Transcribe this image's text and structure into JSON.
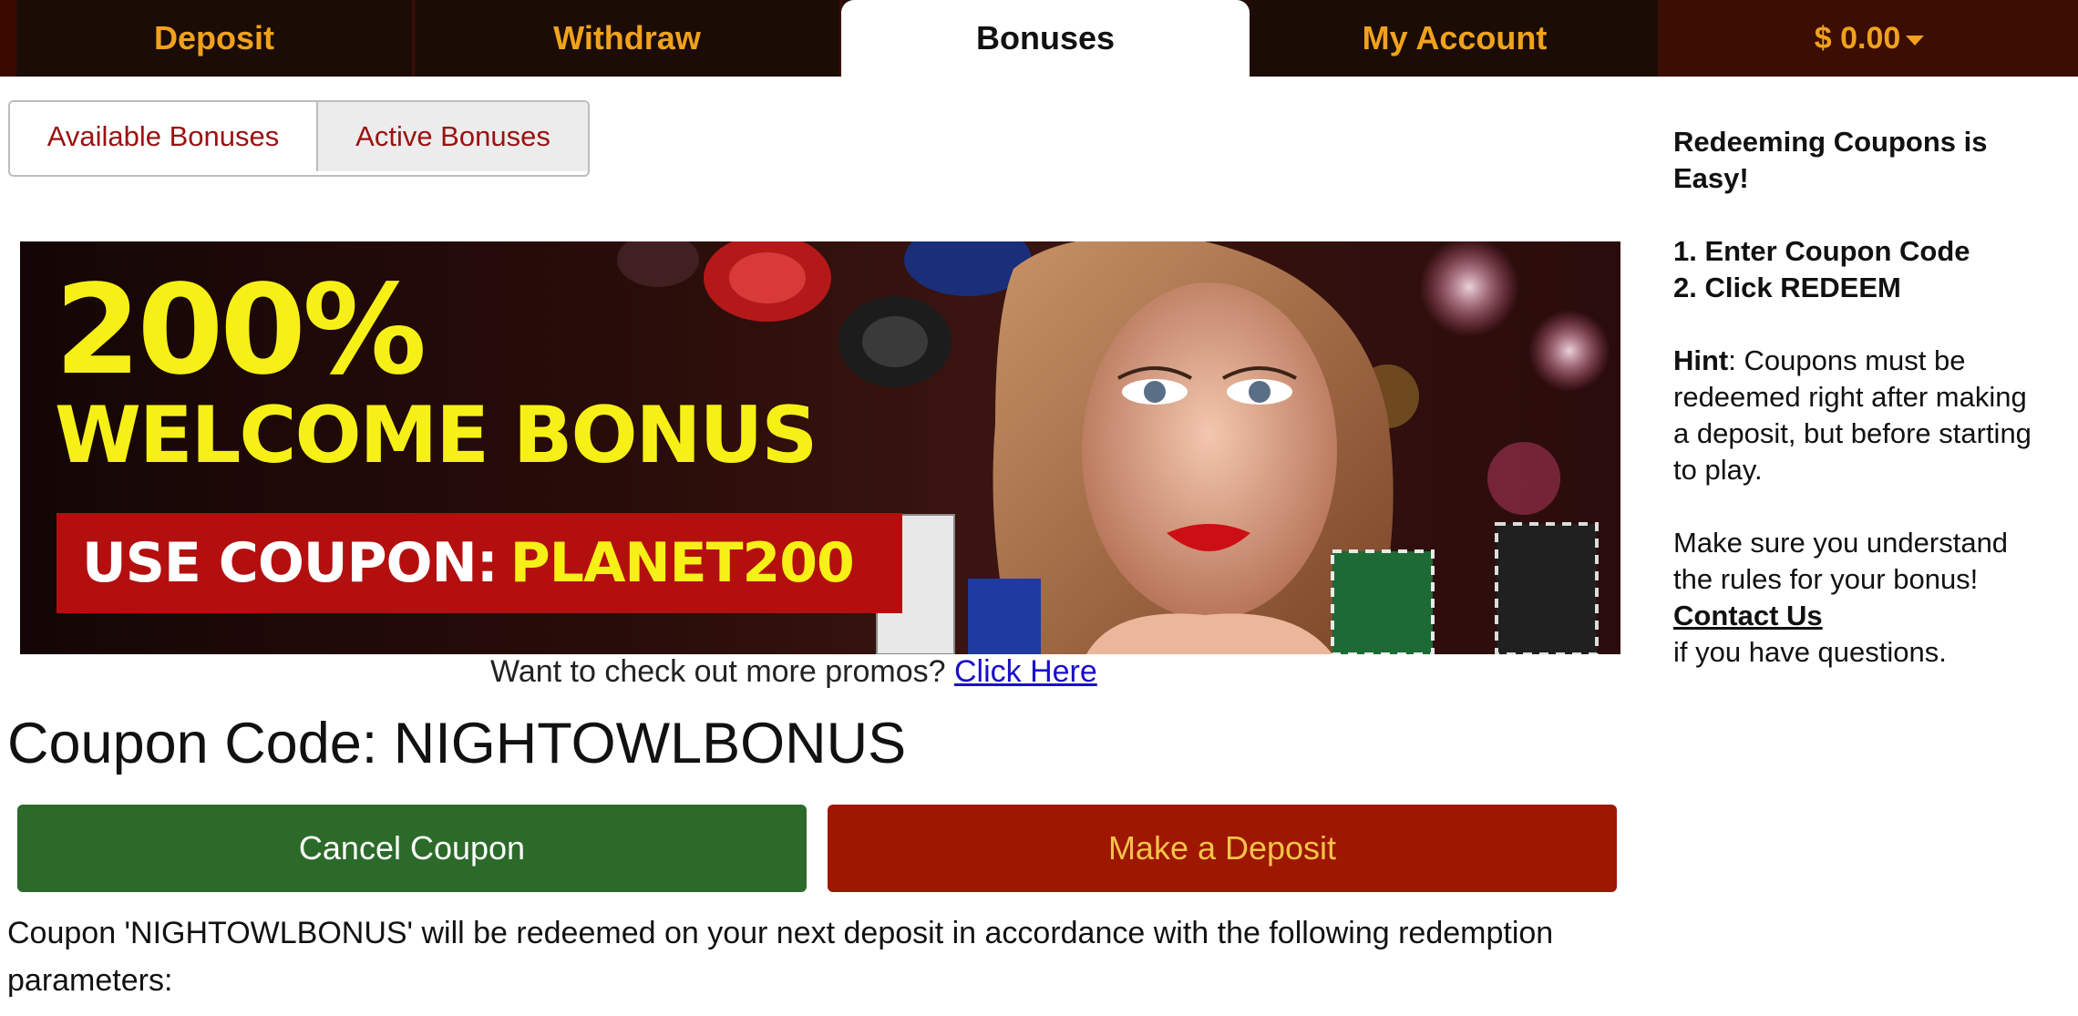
{
  "nav": {
    "deposit": "Deposit",
    "withdraw": "Withdraw",
    "bonuses": "Bonuses",
    "my_account": "My Account",
    "balance": "$ 0.00"
  },
  "subtabs": {
    "available": "Available Bonuses",
    "active": "Active Bonuses"
  },
  "banner": {
    "percent": "200%",
    "headline": "WELCOME BONUS",
    "coupon_label": "USE COUPON:",
    "coupon_code": "PLANET200"
  },
  "promo": {
    "text": "Want to check out more promos?",
    "link": "Click Here"
  },
  "coupon": {
    "title": "Coupon Code: NIGHTOWLBONUS"
  },
  "buttons": {
    "cancel": "Cancel Coupon",
    "deposit": "Make a Deposit"
  },
  "note": "Coupon 'NIGHTOWLBONUS' will be redeemed on your next deposit in accordance with the following redemption parameters:",
  "sidebar": {
    "heading": "Redeeming Coupons is Easy!",
    "step1_num": "1.",
    "step1": "Enter Coupon Code",
    "step2_num": "2.",
    "step2": "Click REDEEM",
    "hint_label": "Hint",
    "hint_text": ": Coupons must be redeemed right after making a deposit, but before starting to play.",
    "rules_text": "Make sure you understand the rules for your bonus!",
    "contact_link": "Contact Us",
    "questions_text": "if you have questions."
  },
  "colors": {
    "nav_bg": "#1c0c06",
    "nav_text": "#f0a21c",
    "cancel_bg": "#2c6a2a",
    "deposit_bg": "#9e1700",
    "banner_yellow": "#f7f016",
    "banner_red": "#b40f0f"
  }
}
